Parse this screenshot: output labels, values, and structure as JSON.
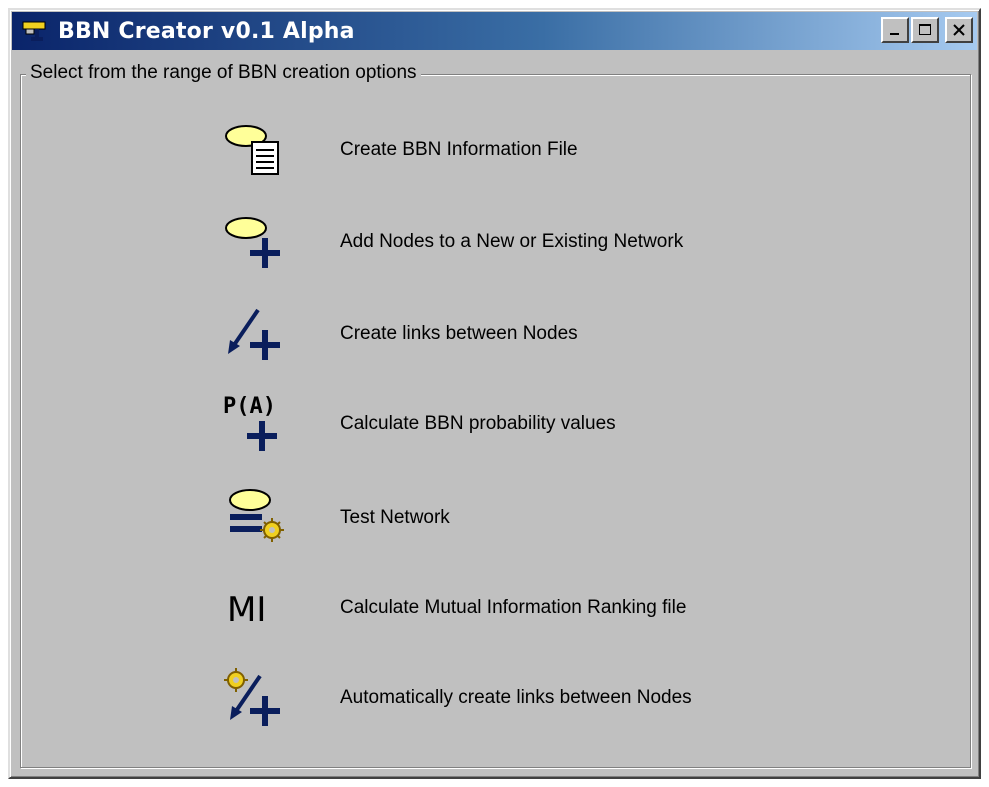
{
  "window": {
    "title": "BBN Creator v0.1 Alpha"
  },
  "titlebar_buttons": [
    {
      "name": "minimize",
      "icon": "minimize-icon"
    },
    {
      "name": "maximize",
      "icon": "maximize-icon"
    },
    {
      "name": "close",
      "icon": "close-icon"
    }
  ],
  "group": {
    "label": "Select from the range of BBN creation options"
  },
  "options": [
    {
      "label": "Create BBN Information File",
      "icon": "node-document-icon"
    },
    {
      "label": "Add Nodes to a New or Existing Network",
      "icon": "add-node-icon"
    },
    {
      "label": "Create links between Nodes",
      "icon": "add-link-icon"
    },
    {
      "label": "Calculate BBN probability values",
      "icon": "probability-icon",
      "icon_text": "P(A)"
    },
    {
      "label": "Test Network",
      "icon": "test-network-icon"
    },
    {
      "label": "Calculate Mutual Information Ranking file",
      "icon": "mutual-information-icon",
      "icon_text": "MI"
    },
    {
      "label": "Automatically create links between Nodes",
      "icon": "auto-link-icon"
    }
  ],
  "colors": {
    "node_fill": "#ffff99",
    "accent_navy": "#0a1e5c",
    "titlebar_start": "#0a246a",
    "titlebar_end": "#a6caf0",
    "face": "#c0c0c0"
  }
}
